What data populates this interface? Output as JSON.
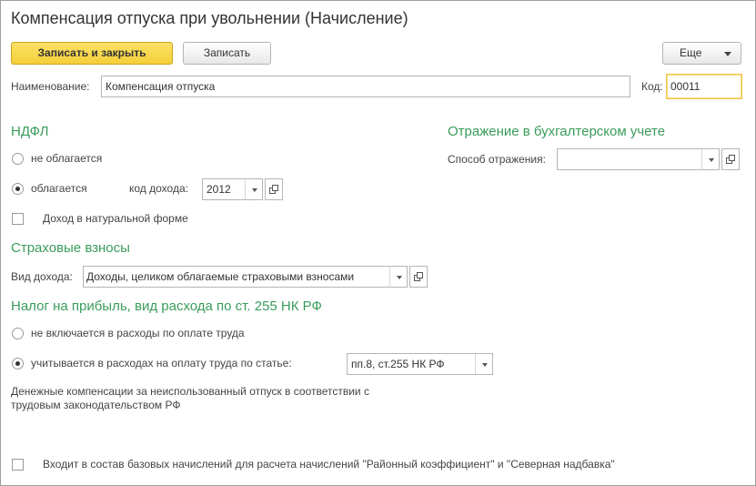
{
  "window": {
    "title": "Компенсация отпуска при увольнении (Начисление)"
  },
  "toolbar": {
    "save_close_label": "Записать и закрыть",
    "save_label": "Записать",
    "more_label": "Еще"
  },
  "form": {
    "name_label": "Наименование:",
    "name_value": "Компенсация отпуска",
    "code_label": "Код:",
    "code_value": "00011"
  },
  "ndfl": {
    "heading": "НДФЛ",
    "not_taxed_label": "не облагается",
    "taxed_label": "облагается",
    "income_code_label": "код дохода:",
    "income_code_value": "2012",
    "in_kind_label": "Доход в натуральной форме",
    "selected": "taxed"
  },
  "accounting": {
    "heading": "Отражение в бухгалтерском учете",
    "method_label": "Способ отражения:",
    "method_value": ""
  },
  "insurance": {
    "heading": "Страховые взносы",
    "income_type_label": "Вид дохода:",
    "income_type_value": "Доходы, целиком облагаемые страховыми взносами"
  },
  "profit_tax": {
    "heading": "Налог на прибыль, вид расхода по ст. 255 НК РФ",
    "not_included_label": "не включается в расходы по оплате труда",
    "included_label": "учитывается в расходах на оплату труда по статье:",
    "article_value": "пп.8, ст.255 НК РФ",
    "selected": "included",
    "note": "Денежные компенсации за неиспользованный отпуск в соответствии с трудовым законодательством РФ"
  },
  "footer": {
    "base_accruals_label": "Входит в состав базовых начислений для расчета начислений \"Районный коэффициент\" и \"Северная надбавка\""
  }
}
